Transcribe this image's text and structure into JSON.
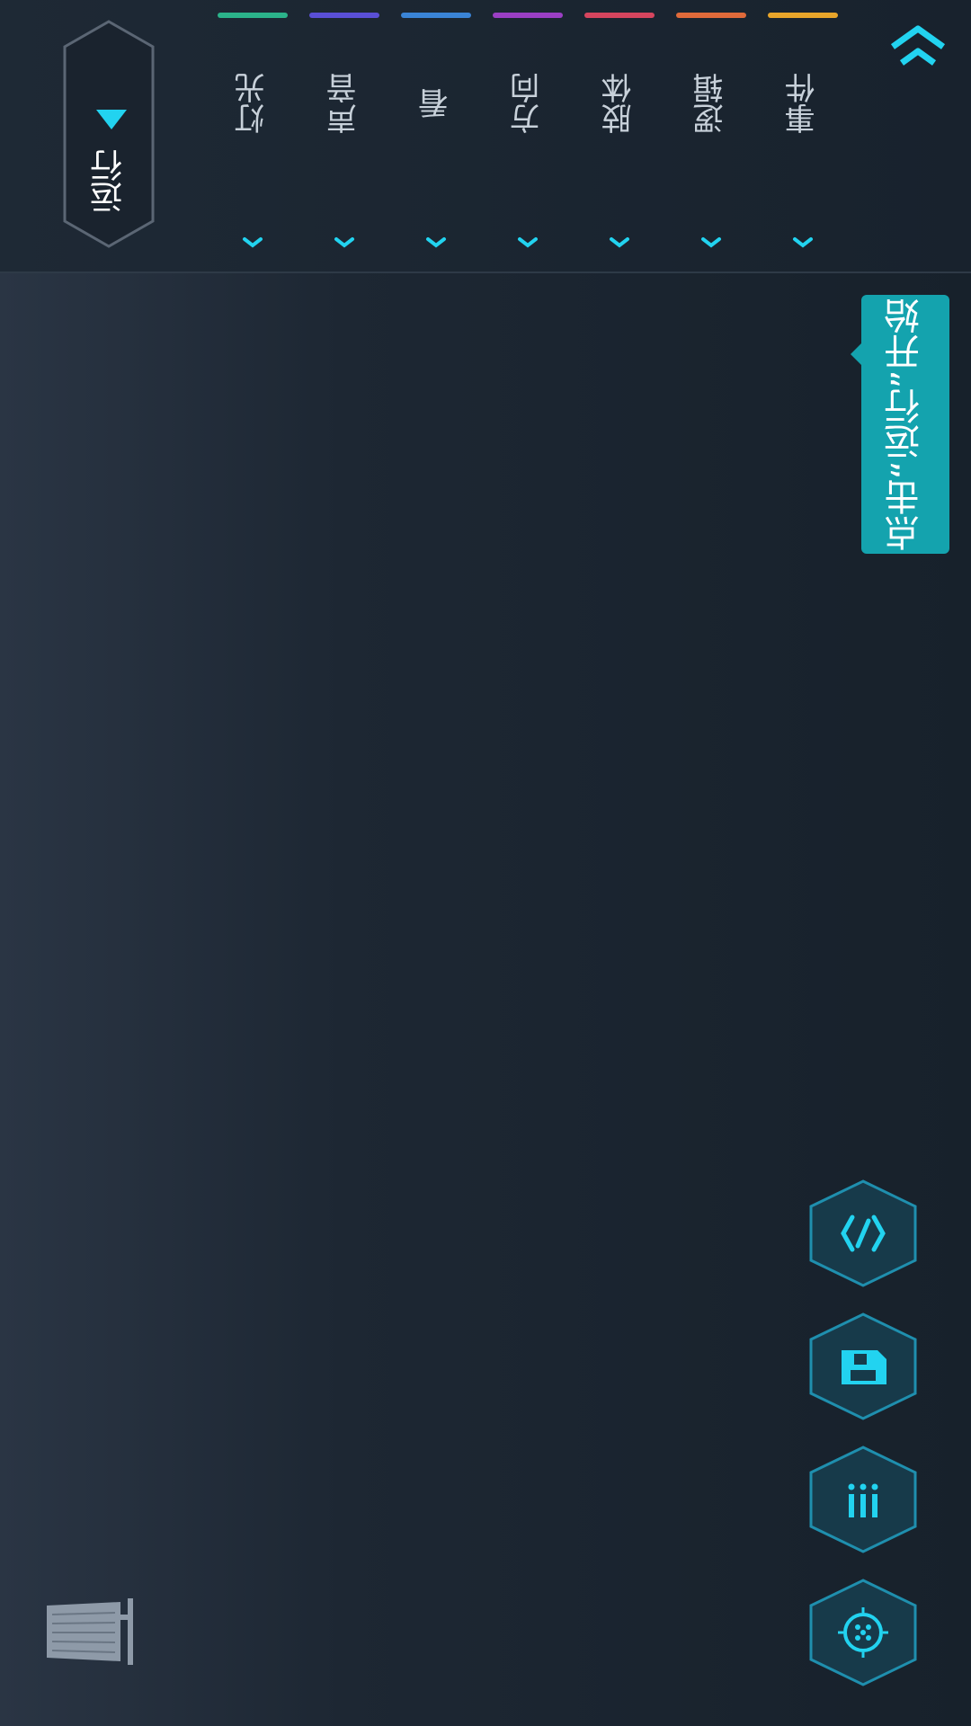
{
  "toolbar": {
    "run_label": "运行",
    "categories": [
      {
        "label": "灯光",
        "color": "#2bb38a"
      },
      {
        "label": "声音",
        "color": "#5a4fd6"
      },
      {
        "label": "看",
        "color": "#3a84d6"
      },
      {
        "label": "方向",
        "color": "#9b3fc4"
      },
      {
        "label": "肢体",
        "color": "#d6455e"
      },
      {
        "label": "逻辑",
        "color": "#e06a3a"
      },
      {
        "label": "事件",
        "color": "#e8a52a"
      }
    ]
  },
  "tooltip": {
    "text": "点击“运行”开始"
  },
  "side_actions": [
    {
      "icon": "code-icon"
    },
    {
      "icon": "save-icon"
    },
    {
      "icon": "menu-icon"
    },
    {
      "icon": "target-icon"
    }
  ],
  "accent_color": "#22d3f0"
}
